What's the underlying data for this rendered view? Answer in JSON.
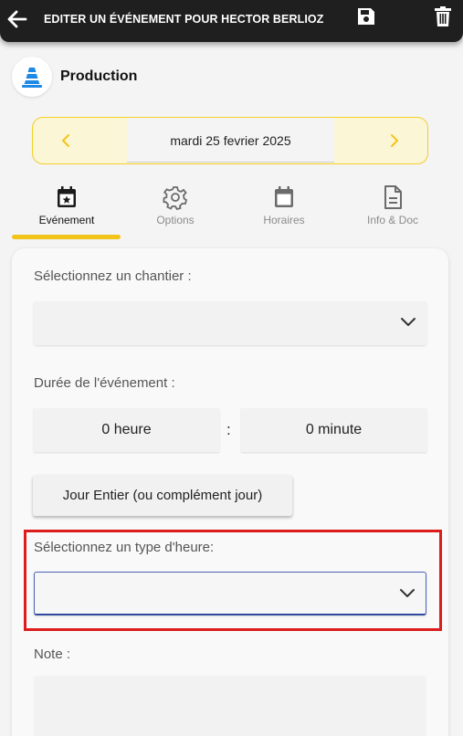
{
  "header": {
    "title": "EDITER UN ÉVÉNEMENT POUR HECTOR BERLIOZ",
    "background": "#1f1f1f"
  },
  "section": {
    "title": "Production",
    "logo_icon": "traffic-cone-icon",
    "logo_color": "#1e88e5"
  },
  "date_nav": {
    "date": "mardi 25 fevrier 2025",
    "accent": "#f2cf2a"
  },
  "tabs": [
    {
      "label": "Evénement",
      "icon": "calendar-star-icon",
      "active": true
    },
    {
      "label": "Options",
      "icon": "gear-icon",
      "active": false
    },
    {
      "label": "Horaires",
      "icon": "calendar-icon",
      "active": false
    },
    {
      "label": "Info & Doc",
      "icon": "document-icon",
      "active": false
    }
  ],
  "form": {
    "chantier_label": "Sélectionnez un chantier :",
    "chantier_value": "",
    "duration_label": "Durée de l'événement :",
    "hours_value": "0 heure",
    "separator": ":",
    "minutes_value": "0 minute",
    "full_day_button": "Jour Entier (ou complément jour)",
    "hour_type_label": "Sélectionnez un type d'heure:",
    "hour_type_value": "",
    "note_label": "Note :",
    "note_value": ""
  },
  "colors": {
    "tab_indicator": "#f2c419",
    "highlight_box": "#dd1c1c",
    "focus_border": "#2f4aa0"
  }
}
